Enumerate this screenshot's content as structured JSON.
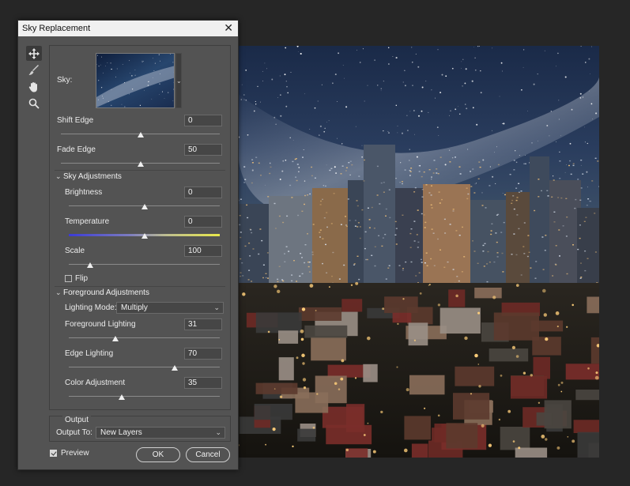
{
  "dialog": {
    "title": "Sky Replacement",
    "close_glyph": "✕"
  },
  "tools": [
    {
      "icon": "move-icon"
    },
    {
      "icon": "sky-brush-icon"
    },
    {
      "icon": "hand-icon"
    },
    {
      "icon": "zoom-icon"
    }
  ],
  "sky": {
    "label": "Sky:",
    "dropdown_glyph": "⌄"
  },
  "shift_edge": {
    "label": "Shift Edge",
    "value": "0",
    "slider": 0.5
  },
  "fade_edge": {
    "label": "Fade Edge",
    "value": "50",
    "slider": 0.5
  },
  "sky_adjustments": {
    "header": "Sky Adjustments",
    "brightness": {
      "label": "Brightness",
      "value": "0",
      "slider": 0.5
    },
    "temperature": {
      "label": "Temperature",
      "value": "0",
      "slider": 0.5
    },
    "scale": {
      "label": "Scale",
      "value": "100",
      "slider": 0.14
    },
    "flip": {
      "label": "Flip",
      "checked": false
    }
  },
  "foreground_adjustments": {
    "header": "Foreground Adjustments",
    "lighting_mode": {
      "label": "Lighting Mode:",
      "value": "Multiply"
    },
    "foreground_lighting": {
      "label": "Foreground Lighting",
      "value": "31",
      "slider": 0.31
    },
    "edge_lighting": {
      "label": "Edge Lighting",
      "value": "70",
      "slider": 0.7
    },
    "color_adjustment": {
      "label": "Color Adjustment",
      "value": "35",
      "slider": 0.35
    }
  },
  "output": {
    "header": "Output",
    "output_to": {
      "label": "Output To:",
      "value": "New Layers"
    }
  },
  "preview": {
    "label": "Preview",
    "checked": true
  },
  "buttons": {
    "ok": "OK",
    "cancel": "Cancel"
  },
  "colors": {
    "dialog_bg": "#535353",
    "titlebar_bg": "#f0f0f0",
    "canvas_bg": "#262626",
    "temperature_cool": "#3b3bd6",
    "temperature_warm": "#e8e84a"
  }
}
